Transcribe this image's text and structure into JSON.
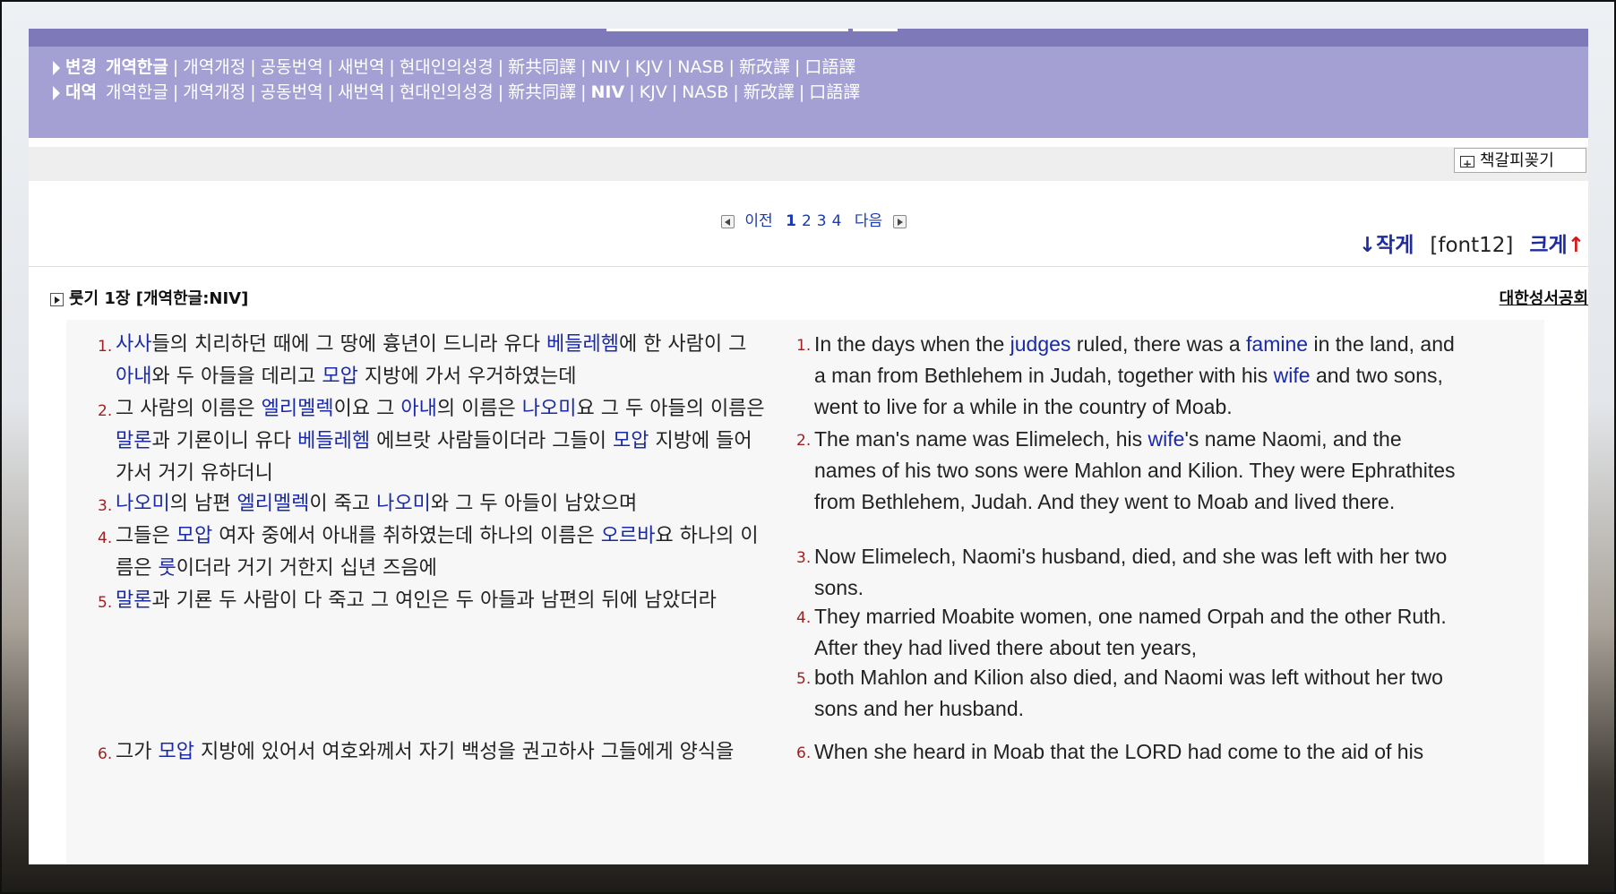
{
  "versions": {
    "change": {
      "label": "변경",
      "items": [
        "개역한글",
        "개역개정",
        "공동번역",
        "새번역",
        "현대인의성경",
        "新共同譯",
        "NIV",
        "KJV",
        "NASB",
        "新改譯",
        "口語譯"
      ],
      "active": "개역한글"
    },
    "compare": {
      "label": "대역",
      "items": [
        "개역한글",
        "개역개정",
        "공동번역",
        "새번역",
        "현대인의성경",
        "新共同譯",
        "NIV",
        "KJV",
        "NASB",
        "新改譯",
        "口語譯"
      ],
      "active": "NIV"
    }
  },
  "toolbar": {
    "bookmark_label": "책갈피꽂기"
  },
  "pager": {
    "prev": "이전",
    "pages": [
      "1",
      "2",
      "3",
      "4"
    ],
    "current": "1",
    "next": "다음"
  },
  "font_control": {
    "smaller": "↓작게",
    "current": "[font12]",
    "larger": "크게",
    "larger_arrow": "↑"
  },
  "chapter": {
    "title": "룻기 1장 [개역한글:NIV]",
    "publisher": "대한성서공회"
  },
  "verses_ko": [
    {
      "num": "1.",
      "segments": [
        {
          "t": "사사",
          "k": true
        },
        {
          "t": "들의 치리하던 때에 그 땅에 흉년이 드니라 유다 "
        },
        {
          "t": "베들레헴",
          "k": true
        },
        {
          "t": "에 한 사람이 그 "
        },
        {
          "t": "아내",
          "k": true
        },
        {
          "t": "와 두 아들을 데리고 "
        },
        {
          "t": "모압",
          "k": true
        },
        {
          "t": " 지방에 가서 우거하였는데"
        }
      ]
    },
    {
      "num": "2.",
      "segments": [
        {
          "t": "그 사람의 이름은 "
        },
        {
          "t": "엘리멜렉",
          "k": true
        },
        {
          "t": "이요 그 "
        },
        {
          "t": "아내",
          "k": true
        },
        {
          "t": "의 이름은 "
        },
        {
          "t": "나오미",
          "k": true
        },
        {
          "t": "요 그 두 아들의 이름은 "
        },
        {
          "t": "말론",
          "k": true
        },
        {
          "t": "과 기룐이니 유다 "
        },
        {
          "t": "베들레헴",
          "k": true
        },
        {
          "t": " 에브랏 사람들이더라 그들이 "
        },
        {
          "t": "모압",
          "k": true
        },
        {
          "t": " 지방에 들어가서 거기 유하더니"
        }
      ]
    },
    {
      "num": "3.",
      "segments": [
        {
          "t": "나오미",
          "k": true
        },
        {
          "t": "의 남편 "
        },
        {
          "t": "엘리멜렉",
          "k": true
        },
        {
          "t": "이 죽고 "
        },
        {
          "t": "나오미",
          "k": true
        },
        {
          "t": "와 그 두 아들이 남았으며"
        }
      ]
    },
    {
      "num": "4.",
      "segments": [
        {
          "t": "그들은 "
        },
        {
          "t": "모압",
          "k": true
        },
        {
          "t": " 여자 중에서 아내를 취하였는데 하나의 이름은 "
        },
        {
          "t": "오르바",
          "k": true
        },
        {
          "t": "요 하나의 이름은 "
        },
        {
          "t": "룻",
          "k": true
        },
        {
          "t": "이더라 거기 거한지 십년 즈음에"
        }
      ]
    },
    {
      "num": "5.",
      "segments": [
        {
          "t": "말론",
          "k": true
        },
        {
          "t": "과 기룐 두 사람이 다 죽고 그 여인은 두 아들과 남편의 뒤에 남았더라"
        }
      ]
    },
    {
      "num": "6.",
      "segments": [
        {
          "t": "그가 "
        },
        {
          "t": "모압",
          "k": true
        },
        {
          "t": " 지방에 있어서 여호와께서 자기 백성을 권고하사 그들에게 양식을"
        }
      ]
    }
  ],
  "verses_en": [
    {
      "num": "1.",
      "segments": [
        {
          "t": "In the days when the "
        },
        {
          "t": "judges",
          "k": true
        },
        {
          "t": " ruled, there was a "
        },
        {
          "t": "famine",
          "k": true
        },
        {
          "t": " in the land, and a man from Bethlehem in Judah, together with his "
        },
        {
          "t": "wife",
          "k": true
        },
        {
          "t": " and two sons, went to live for a while in the country of Moab."
        }
      ]
    },
    {
      "num": "2.",
      "segments": [
        {
          "t": "The man's name was Elimelech, his "
        },
        {
          "t": "wife",
          "k": true
        },
        {
          "t": "'s name Naomi, and the names of his two sons were Mahlon and Kilion. They were Ephrathites from Bethlehem, Judah. And they went to Moab and lived there."
        }
      ]
    },
    {
      "num": "3.",
      "segments": [
        {
          "t": "Now Elimelech, Naomi's husband, died, and she was left with her two sons."
        }
      ]
    },
    {
      "num": "4.",
      "segments": [
        {
          "t": "They married Moabite women, one named Orpah and the other Ruth. After they had lived there about ten years,"
        }
      ]
    },
    {
      "num": "5.",
      "segments": [
        {
          "t": "both Mahlon and Kilion also died, and Naomi was left without her two sons and her husband."
        }
      ]
    },
    {
      "num": "6.",
      "segments": [
        {
          "t": "When she heard in Moab that the LORD had come to the aid of his"
        }
      ]
    }
  ]
}
